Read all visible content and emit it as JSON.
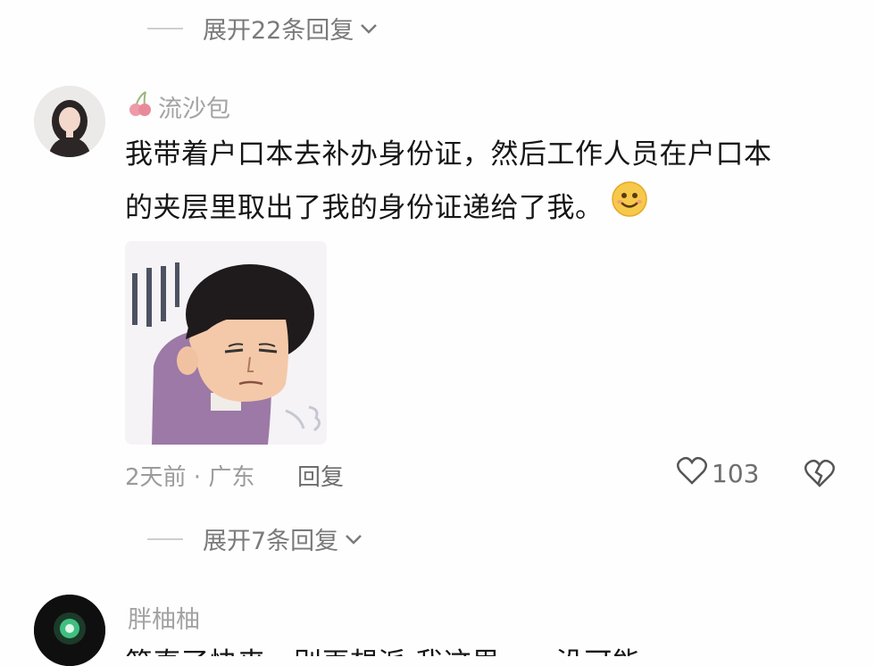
{
  "expand_top": {
    "label": "展开22条回复"
  },
  "comment1": {
    "username": "流沙包",
    "text_line1": "我带着户口本去补办身份证，然后工作人员在户口本",
    "text_line2": "的夹层里取出了我的身份证递给了我。",
    "time_location": "2天前 · 广东",
    "reply_label": "回复",
    "like_count": "103"
  },
  "expand_mid": {
    "label": "展开7条回复"
  },
  "comment2": {
    "username": "胖柚柚",
    "text_partial": "简直了快来，别再想派 我这里……没可能"
  },
  "colors": {
    "meta": "#9b9b9b",
    "text": "#161616",
    "accent_cherry": "#e98a9b"
  }
}
